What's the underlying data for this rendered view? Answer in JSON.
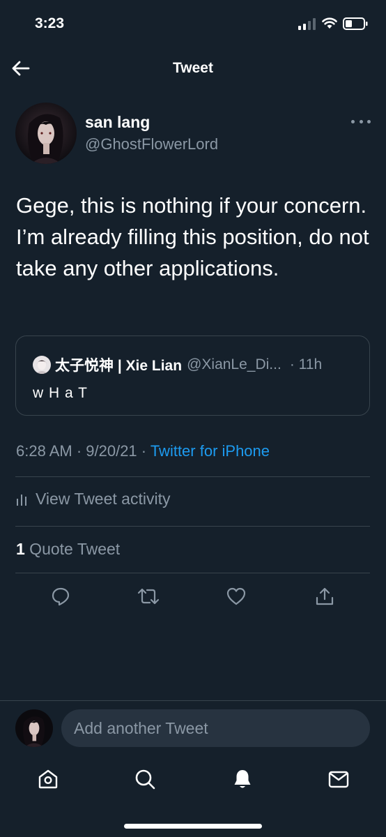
{
  "status_bar": {
    "time": "3:23"
  },
  "header": {
    "title": "Tweet"
  },
  "tweet": {
    "display_name": "san lang",
    "handle": "@GhostFlowerLord",
    "text": "Gege, this is nothing if your concern. I’m already filling this position, do not take any other applications.",
    "timestamp": "6:28 AM · 9/20/21 · ",
    "source": "Twitter for iPhone"
  },
  "quoted_tweet": {
    "display_name": "太子悦神 | Xie Lian",
    "handle": "@XianLe_Di...",
    "time": "· 11h",
    "text": "w H a T"
  },
  "activity": {
    "label": "View Tweet activity"
  },
  "quote_tweets": {
    "count": "1",
    "label": " Quote Tweet"
  },
  "actions": [
    {
      "icon": "reply-icon"
    },
    {
      "icon": "retweet-icon"
    },
    {
      "icon": "like-icon"
    },
    {
      "icon": "share-icon"
    }
  ],
  "composer": {
    "placeholder": "Add another Tweet"
  },
  "bottom_nav": [
    {
      "icon": "home-icon"
    },
    {
      "icon": "search-icon"
    },
    {
      "icon": "notifications-icon",
      "active": true
    },
    {
      "icon": "messages-icon"
    }
  ],
  "colors": {
    "background": "#15202b",
    "secondary_text": "#8b98a5",
    "accent": "#1d9bf0",
    "border": "#38444d"
  }
}
